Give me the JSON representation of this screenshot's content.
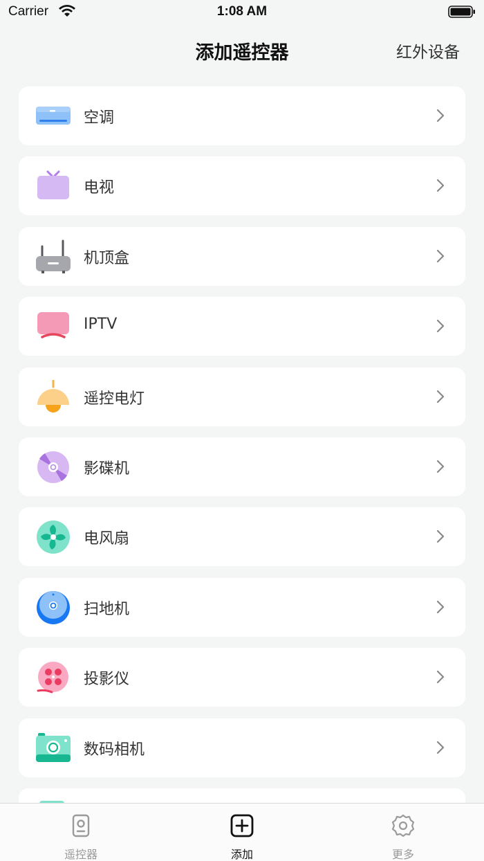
{
  "status_bar": {
    "carrier": "Carrier",
    "time": "1:08 AM"
  },
  "nav": {
    "title": "添加遥控器",
    "right_action": "红外设备"
  },
  "devices": [
    {
      "label": "空调",
      "icon": "air-conditioner-icon"
    },
    {
      "label": "电视",
      "icon": "tv-icon"
    },
    {
      "label": "机顶盒",
      "icon": "set-top-box-icon"
    },
    {
      "label": "IPTV",
      "icon": "iptv-icon"
    },
    {
      "label": "遥控电灯",
      "icon": "lamp-icon"
    },
    {
      "label": "影碟机",
      "icon": "disc-player-icon"
    },
    {
      "label": "电风扇",
      "icon": "fan-icon"
    },
    {
      "label": "扫地机",
      "icon": "robot-vacuum-icon"
    },
    {
      "label": "投影仪",
      "icon": "projector-icon"
    },
    {
      "label": "数码相机",
      "icon": "camera-icon"
    }
  ],
  "tabs": [
    {
      "label": "遥控器",
      "icon": "remote-icon",
      "active": false
    },
    {
      "label": "添加",
      "icon": "add-icon",
      "active": true
    },
    {
      "label": "更多",
      "icon": "gear-icon",
      "active": false
    }
  ],
  "colors": {
    "background": "#f4f5f5",
    "card": "#ffffff",
    "tab_active": "#111111",
    "tab_inactive": "#999999"
  }
}
